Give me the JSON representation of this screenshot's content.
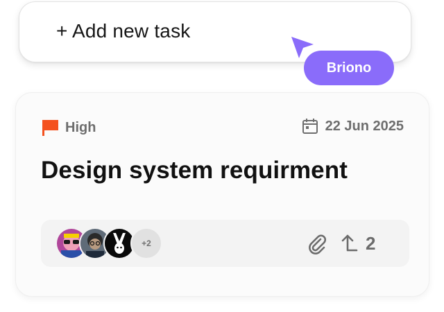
{
  "add_task": {
    "label": "+ Add new task"
  },
  "collaborator": {
    "name": "Briono",
    "cursor_color": "#8a6cfa"
  },
  "task": {
    "priority": {
      "label": "High",
      "color": "#f4511e",
      "icon": "flag-icon"
    },
    "due_date": {
      "label": "22 Jun 2025",
      "icon": "calendar-icon"
    },
    "title": "Design system requirment",
    "assignees": {
      "visible": [
        "avatar-1",
        "avatar-2",
        "avatar-3"
      ],
      "more_label": "+2"
    },
    "attachment_icon": "paperclip-icon",
    "subtask_icon": "subtask-arrow-icon",
    "subtask_count": "2"
  }
}
